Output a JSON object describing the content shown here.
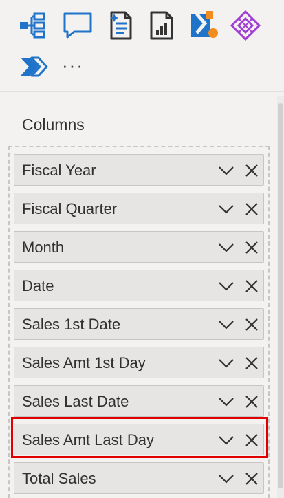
{
  "toolbar": {
    "icons": [
      "decomposition-tree-icon",
      "qa-icon",
      "smart-narrative-icon",
      "paginated-report-icon",
      "power-automate-icon",
      "power-apps-icon",
      "power-automate-flow-icon"
    ],
    "more_label": "···"
  },
  "columns": {
    "title": "Columns",
    "fields": [
      {
        "label": "Fiscal Year"
      },
      {
        "label": "Fiscal Quarter"
      },
      {
        "label": "Month"
      },
      {
        "label": "Date"
      },
      {
        "label": "Sales 1st Date"
      },
      {
        "label": "Sales Amt 1st Day"
      },
      {
        "label": "Sales Last Date"
      },
      {
        "label": "Sales Amt Last Day",
        "highlighted": true
      },
      {
        "label": "Total Sales"
      }
    ]
  },
  "colors": {
    "highlight": "#e00000",
    "accent": "#1f74c9",
    "power_apps": "#a23dd3"
  }
}
